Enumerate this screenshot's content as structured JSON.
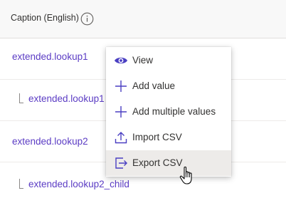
{
  "header": {
    "title": "Caption (English)",
    "info_icon": "info-icon"
  },
  "rows": [
    {
      "label": "extended.lookup1",
      "indent": false
    },
    {
      "label": "extended.lookup1",
      "indent": true
    },
    {
      "label": "extended.lookup2",
      "indent": false
    },
    {
      "label": "extended.lookup2_child",
      "indent": true
    }
  ],
  "context_menu": {
    "items": [
      {
        "label": "View",
        "icon": "eye-icon",
        "hovered": false
      },
      {
        "label": "Add value",
        "icon": "plus-icon",
        "hovered": false
      },
      {
        "label": "Add multiple values",
        "icon": "plus-icon",
        "hovered": false
      },
      {
        "label": "Import CSV",
        "icon": "upload-icon",
        "hovered": false
      },
      {
        "label": "Export CSV",
        "icon": "export-icon",
        "hovered": true
      }
    ]
  },
  "colors": {
    "link": "#5b3cc4",
    "accent": "#4a3fc2",
    "hover_bg": "#edebe9"
  }
}
